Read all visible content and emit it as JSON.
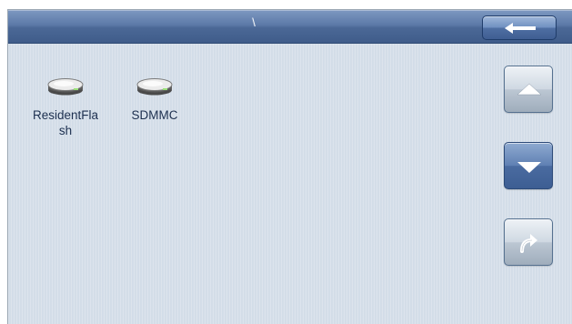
{
  "titlebar": {
    "path": "\\",
    "back_icon": "arrow-left-icon"
  },
  "drives": [
    {
      "label": "ResidentFlash",
      "icon": "drive-icon"
    },
    {
      "label": "SDMMC",
      "icon": "drive-icon"
    }
  ],
  "nav": {
    "up_icon": "triangle-up-icon",
    "down_icon": "triangle-down-icon",
    "open_icon": "curved-arrow-icon"
  },
  "colors": {
    "background": "#d3dde8",
    "titlebar": "#5d7aa8",
    "accent_button": "#4a6ba0"
  }
}
